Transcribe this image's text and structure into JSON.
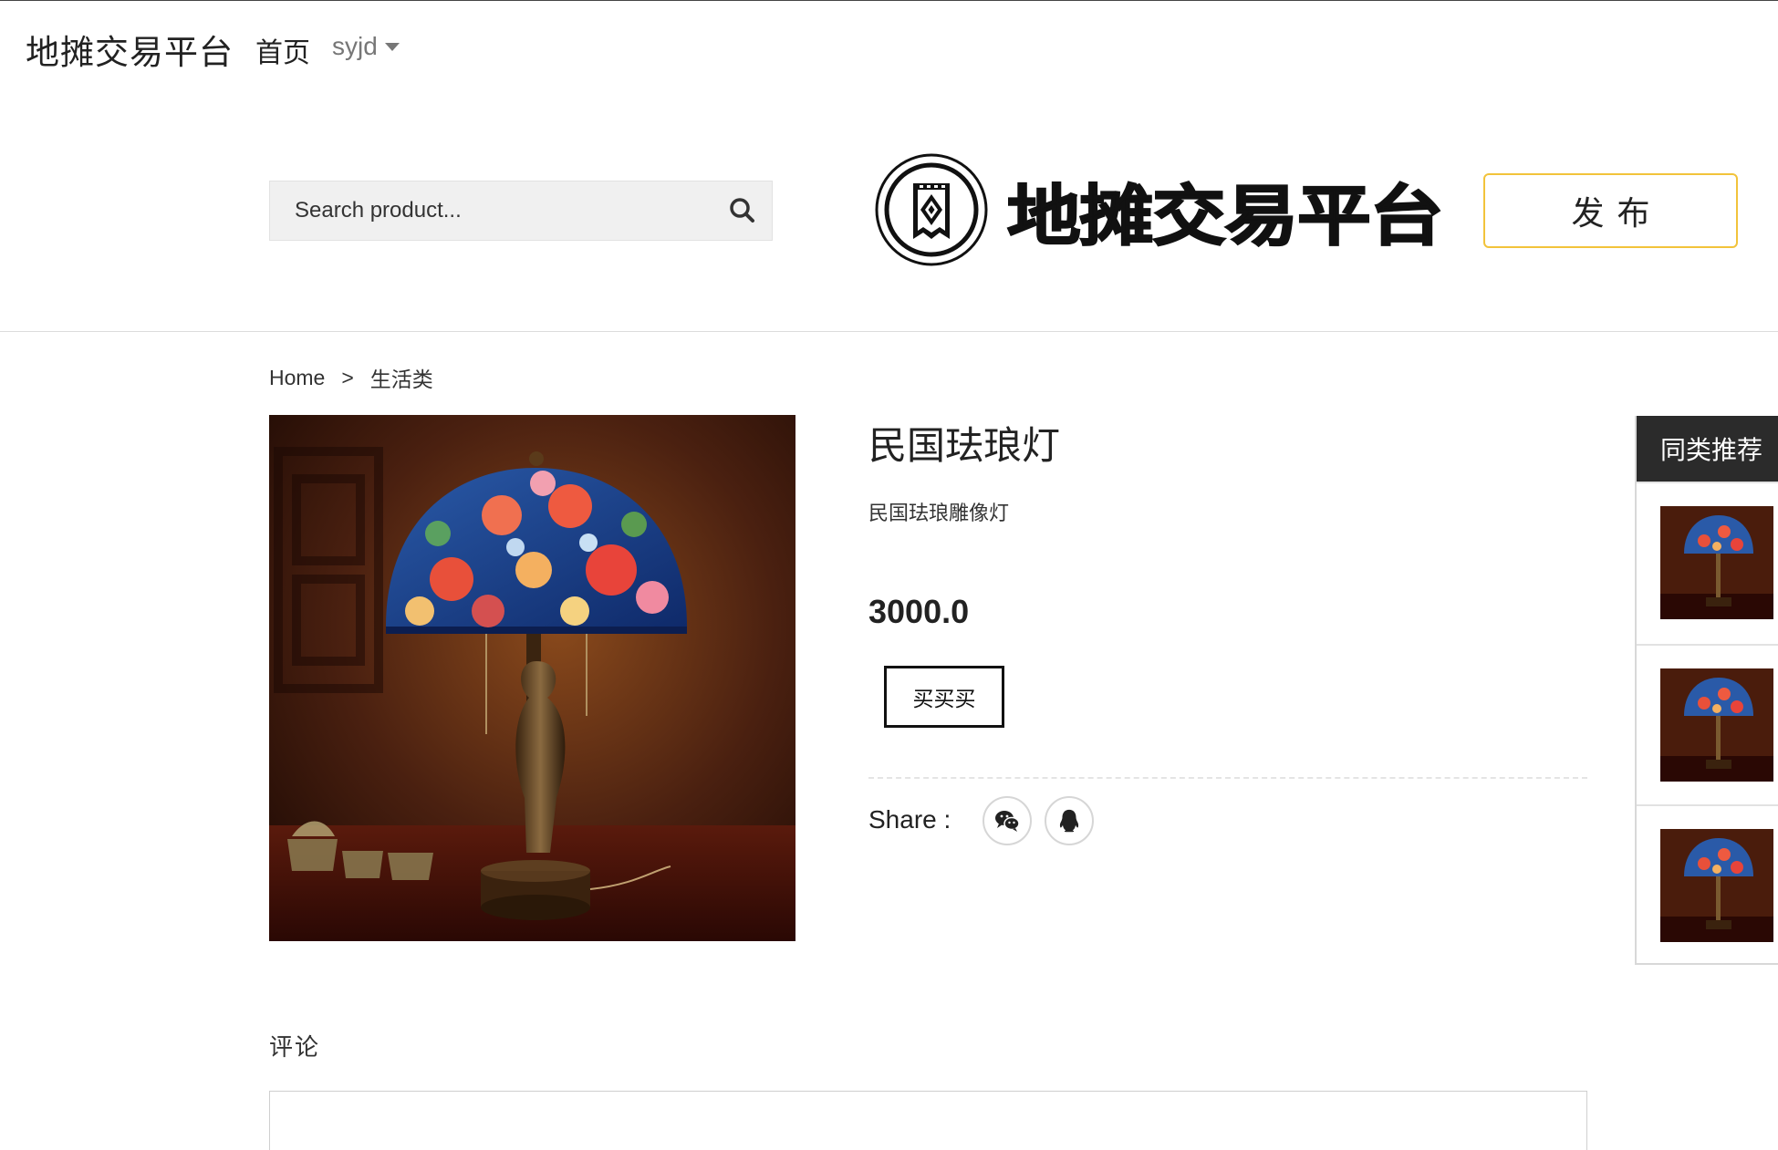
{
  "navbar": {
    "brand": "地摊交易平台",
    "home": "首页",
    "user": "syjd"
  },
  "search": {
    "placeholder": "Search product..."
  },
  "logo": {
    "text": "地摊交易平台"
  },
  "publish": {
    "label": "发布"
  },
  "breadcrumb": {
    "home": "Home",
    "separator": ">",
    "category": "生活类"
  },
  "product": {
    "title": "民国珐琅灯",
    "description": "民国珐琅雕像灯",
    "price": "3000.0",
    "buy_label": "买买买"
  },
  "share": {
    "label": "Share :",
    "icons": [
      "wechat-icon",
      "qq-icon"
    ]
  },
  "sidebar": {
    "title": "同类推荐",
    "item_count_note": "three thumbnail items shown"
  },
  "comments": {
    "title": "评论"
  },
  "colors": {
    "publish_border": "#f2c33b",
    "sidebar_header_bg": "#2b2b2b",
    "text": "#222222"
  }
}
